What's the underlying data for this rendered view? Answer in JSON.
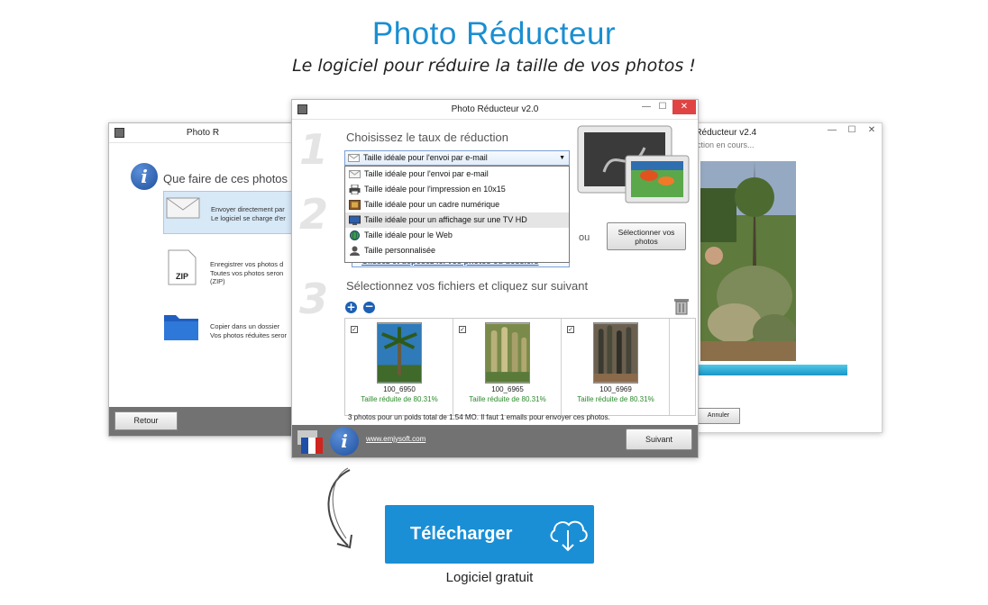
{
  "hero": {
    "title": "Photo Réducteur",
    "subtitle": "Le logiciel pour réduire la taille de vos photos !"
  },
  "left_window": {
    "title": "Photo R",
    "question": "Que faire de ces photos",
    "options": [
      {
        "icon": "envelope-icon",
        "line1": "Envoyer directement par",
        "line2": "Le logiciel se charge d'er"
      },
      {
        "icon": "zip-file-icon",
        "line1": "Enregistrer vos photos d",
        "line2": "Toutes vos photos seron",
        "line3": "(ZIP)"
      },
      {
        "icon": "folder-icon",
        "line1": "Copier dans un dossier",
        "line2": "Vos photos réduites seror"
      }
    ],
    "back_label": "Retour"
  },
  "right_window": {
    "title": "o Réducteur v2.4",
    "status": "ction en cours...",
    "progress": 1.0,
    "cancel_label": "Annuler"
  },
  "center_window": {
    "title": "Photo Réducteur v2.0",
    "steps": [
      "1",
      "2",
      "3"
    ],
    "step1_title": "Choisissez le taux de réduction",
    "dropdown_selected": "Taille idéale pour l'envoi par e-mail",
    "dropdown_options": [
      {
        "label": "Taille idéale pour l'envoi par e-mail",
        "icon": "envelope-icon"
      },
      {
        "label": "Taille idéale pour l'impression en 10x15",
        "icon": "printer-icon"
      },
      {
        "label": "Taille idéale pour un cadre numérique",
        "icon": "frame-icon"
      },
      {
        "label": "Taille idéale pour un affichage sur une TV HD",
        "icon": "tv-icon"
      },
      {
        "label": "Taille idéale pour le Web",
        "icon": "globe-icon"
      },
      {
        "label": "Taille personnalisée",
        "icon": "user-icon"
      }
    ],
    "or_label": "ou",
    "select_photos_label": "Sélectionner vos photos",
    "dropzone_text": "Glissez et déposez ici vos photos ou dossiers",
    "step3_title": "Sélectionnez vos fichiers et cliquez sur suivant",
    "photos": [
      {
        "name": "100_6950",
        "ratio": "Taille réduite de 80.31%",
        "color": "#2f7ab8"
      },
      {
        "name": "100_6965",
        "ratio": "Taille réduite de 80.31%",
        "color": "#7a8a4a"
      },
      {
        "name": "100_6969",
        "ratio": "Taille réduite de 80.31%",
        "color": "#6b6050"
      }
    ],
    "summary": "3 photos pour un poids total de 1.54 MO. Il faut 1 emails pour envoyer ces photos.",
    "website": "www.emjysoft.com",
    "next_label": "Suivant"
  },
  "download": {
    "button_label": "Télécharger",
    "free_label": "Logiciel gratuit"
  },
  "colors": {
    "accent": "#1a8fd6",
    "footer": "#727272",
    "success": "#2a8a2a"
  }
}
